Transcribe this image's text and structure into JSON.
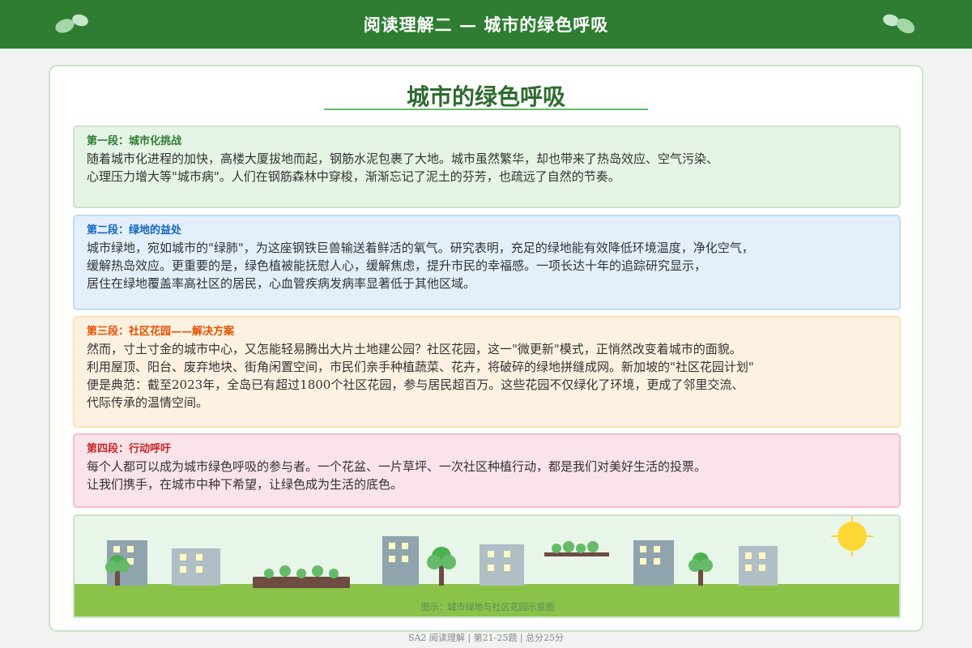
{
  "header": {
    "title": "阅读理解二 — 城市的绿色呼吸",
    "left_icon": "leaf-icon",
    "right_icon": "leaf-icon",
    "bg_color": "#2e7d32"
  },
  "article": {
    "title": "城市的绿色呼吸",
    "paragraphs": [
      {
        "heading": "第一段：城市化挑战",
        "lines": [
          "随着城市化进程的加快，高楼大厦拔地而起，钢筋水泥包裹了大地。城市虽然繁华，却也带来了热岛效应、空气污染、",
          "心理压力增大等\"城市病\"。人们在钢筋森林中穿梭，渐渐忘记了泥土的芬芳，也疏远了自然的节奏。"
        ]
      },
      {
        "heading": "第二段：绿地的益处",
        "lines": [
          "城市绿地，宛如城市的\"绿肺\"，为这座钢铁巨兽输送着鲜活的氧气。研究表明，充足的绿地能有效降低环境温度，净化空气，",
          "缓解热岛效应。更重要的是，绿色植被能抚慰人心，缓解焦虑，提升市民的幸福感。一项长达十年的追踪研究显示，",
          "居住在绿地覆盖率高社区的居民，心血管疾病发病率显著低于其他区域。"
        ]
      },
      {
        "heading": "第三段：社区花园——解决方案",
        "lines": [
          "然而，寸土寸金的城市中心，又怎能轻易腾出大片土地建公园？社区花园，这一\"微更新\"模式，正悄然改变着城市的面貌。",
          "利用屋顶、阳台、废弃地块、街角闲置空间，市民们亲手种植蔬菜、花卉，将破碎的绿地拼缝成网。新加坡的\"社区花园计划\"",
          "便是典范：截至2023年，全岛已有超过1800个社区花园，参与居民超百万。这些花园不仅绿化了环境，更成了邻里交流、",
          "代际传承的温情空间。"
        ]
      },
      {
        "heading": "第四段：行动呼吁",
        "lines": [
          "每个人都可以成为城市绿色呼吸的参与者。一个花盆、一片草坪、一次社区种植行动，都是我们对美好生活的投票。",
          "让我们携手，在城市中种下希望，让绿色成为生活的底色。"
        ]
      }
    ]
  },
  "illustration": {
    "caption": "图示：城市绿地与社区花园示意图",
    "elements": [
      "building-icon",
      "tree-icon",
      "garden-bed-icon",
      "rooftop-garden-icon",
      "sun-icon",
      "grass-ground"
    ]
  },
  "footer": {
    "text": "SA2 阅读理解 | 第21-25题 | 总分25分"
  }
}
